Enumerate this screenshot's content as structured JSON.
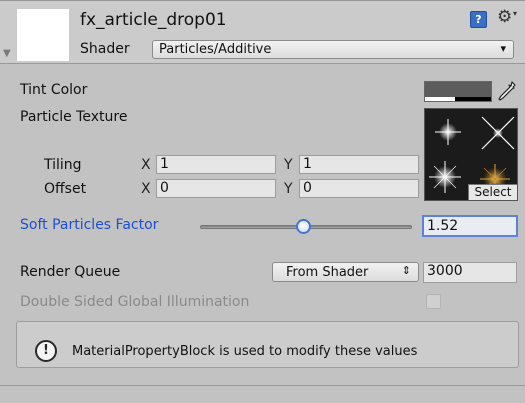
{
  "header": {
    "title": "fx_article_drop01",
    "shader_label": "Shader",
    "shader_value": "Particles/Additive",
    "dropdown_arrow": "▾",
    "fold_arrow": "▼",
    "help_icon": "help-book-icon",
    "settings_icon": "gear-icon"
  },
  "properties": {
    "tint_color_label": "Tint Color",
    "particle_texture_label": "Particle Texture",
    "texture_select_label": "Select",
    "tiling_label": "Tiling",
    "offset_label": "Offset",
    "x_label": "X",
    "y_label": "Y",
    "tiling_x": "1",
    "tiling_y": "1",
    "offset_x": "0",
    "offset_y": "0",
    "soft_particles_label": "Soft Particles Factor",
    "soft_particles_value": "1.52",
    "soft_particles_slider_fraction": 0.49,
    "tint_alpha_fraction": 0.45,
    "tint_color_hex": "#5c5c5c"
  },
  "render": {
    "render_queue_label": "Render Queue",
    "render_queue_mode": "From Shader",
    "render_queue_value": "3000",
    "double_sided_label": "Double Sided Global Illumination",
    "double_sided_checked": false
  },
  "helpbox": {
    "message": "MaterialPropertyBlock is used to modify these values",
    "icon": "info-icon"
  },
  "colors": {
    "accent_blue": "#1a4fd6",
    "focus_border": "#5b82d6",
    "panel_bg": "#c2c2c2"
  }
}
